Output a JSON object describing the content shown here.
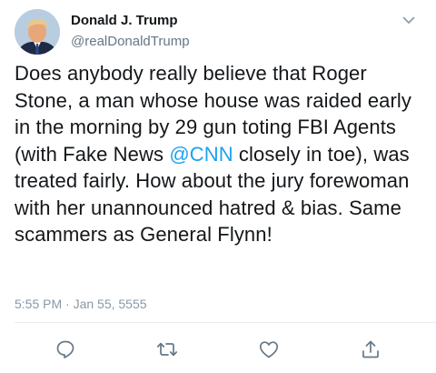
{
  "author": {
    "name": "Donald J. Trump",
    "handle": "@realDonaldTrump",
    "avatar_icon": "profile-photo"
  },
  "tweet": {
    "text_before": "Does anybody really believe that Roger Stone, a man whose house was raided early in the morning by 29 gun toting FBI Agents (with Fake News ",
    "mention": "@CNN",
    "text_after": " closely in toe), was treated fairly. How about the jury forewoman with her unannounced hatred & bias. Same scammers as General Flynn!",
    "timestamp": "5:55 PM · Jan 55, 5555"
  },
  "icons": {
    "menu": "chevron-down-icon",
    "reply": "comment-icon",
    "retweet": "retweet-icon",
    "like": "heart-icon",
    "share": "share-icon"
  },
  "colors": {
    "text": "#14171a",
    "secondary": "#657786",
    "timestamp": "#8899a6",
    "link": "#1da1f2",
    "icon": "#657786",
    "divider": "#e6ecf0"
  }
}
